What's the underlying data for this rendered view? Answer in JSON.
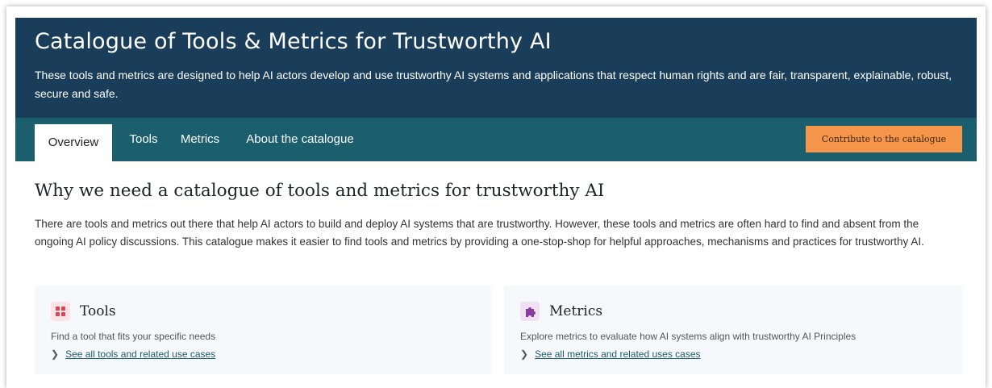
{
  "header": {
    "title": "Catalogue of Tools & Metrics for Trustworthy AI",
    "description": "These tools and metrics are designed to help AI actors develop and use trustworthy AI systems and applications that respect human rights and are fair, transparent, explainable, robust, secure and safe."
  },
  "nav": {
    "tabs": [
      {
        "label": "Overview",
        "active": true
      },
      {
        "label": "Tools",
        "active": false
      },
      {
        "label": "Metrics",
        "active": false
      },
      {
        "label": "About the catalogue",
        "active": false
      }
    ],
    "contribute_label": "Contribute to the catalogue"
  },
  "section": {
    "title": "Why we need a catalogue of tools and metrics for trustworthy AI",
    "body": "There are tools and metrics out there that help AI actors to build and deploy AI systems that are trustworthy. However, these tools and metrics are often hard to find and absent from the ongoing AI policy discussions. This catalogue makes it easier to find tools and metrics by providing a one-stop-shop for helpful approaches, mechanisms and practices for trustworthy AI."
  },
  "cards": [
    {
      "title": "Tools",
      "icon": "grid-icon",
      "icon_color": "#e0425a",
      "icon_bg": "#fbe3e6",
      "description": "Find a tool that fits your specific needs",
      "link": "See all tools and related use cases"
    },
    {
      "title": "Metrics",
      "icon": "puzzle-icon",
      "icon_color": "#8a3c9e",
      "icon_bg": "#efe1f3",
      "description": "Explore metrics to evaluate how AI systems align with trustworthy AI Principles",
      "link": "See all metrics and related uses cases"
    }
  ],
  "colors": {
    "header_bg": "#1a3d5a",
    "nav_bg": "#1b5f6e",
    "accent_button": "#f5964b",
    "card_bg": "#f6f8fb"
  }
}
